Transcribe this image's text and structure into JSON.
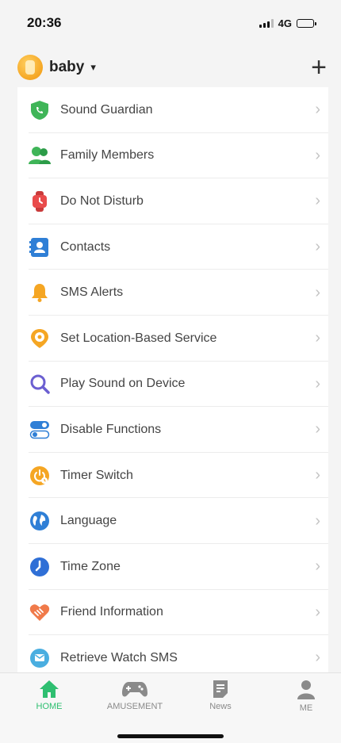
{
  "status_bar": {
    "time": "20:36",
    "network": "4G"
  },
  "header": {
    "device_name": "baby",
    "caret": "▾",
    "add_symbol": "+"
  },
  "menu": [
    {
      "label": "Sound Guardian",
      "icon": "shield-phone-icon",
      "color": "#3fb558"
    },
    {
      "label": "Family Members",
      "icon": "family-icon",
      "color": "#3fb558"
    },
    {
      "label": "Do Not Disturb",
      "icon": "watch-icon",
      "color": "#e94b4b"
    },
    {
      "label": "Contacts",
      "icon": "contacts-icon",
      "color": "#2f7fd6"
    },
    {
      "label": "SMS Alerts",
      "icon": "bell-icon",
      "color": "#f5a623"
    },
    {
      "label": "Set Location-Based Service",
      "icon": "location-pin-icon",
      "color": "#f5a623"
    },
    {
      "label": "Play Sound on Device",
      "icon": "search-icon",
      "color": "#6b5fd1"
    },
    {
      "label": "Disable Functions",
      "icon": "toggle-icon",
      "color": "#2f7fd6"
    },
    {
      "label": "Timer Switch",
      "icon": "timer-switch-icon",
      "color": "#f5a623"
    },
    {
      "label": "Language",
      "icon": "globe-icon",
      "color": "#2f7fd6"
    },
    {
      "label": "Time Zone",
      "icon": "clock-icon",
      "color": "#2f6fd6"
    },
    {
      "label": "Friend Information",
      "icon": "handshake-icon",
      "color": "#f07a4a"
    },
    {
      "label": "Retrieve Watch SMS",
      "icon": "message-icon",
      "color": "#4aaee0"
    }
  ],
  "tabs": [
    {
      "label": "HOME",
      "icon": "home-icon",
      "active": true
    },
    {
      "label": "AMUSEMENT",
      "icon": "gamepad-icon",
      "active": false
    },
    {
      "label": "News",
      "icon": "news-icon",
      "active": false
    },
    {
      "label": "ME",
      "icon": "person-icon",
      "active": false
    }
  ],
  "colors": {
    "active_tab": "#2fbf71",
    "inactive_tab": "#8a8a8a",
    "accent_orange": "#f5a623"
  }
}
